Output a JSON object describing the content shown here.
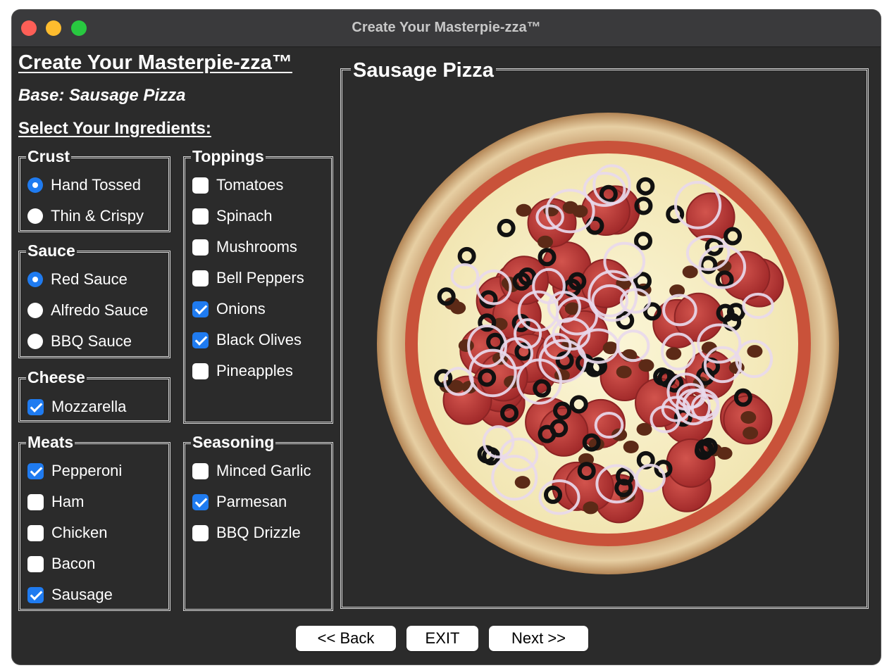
{
  "window": {
    "title": "Create Your Masterpie-zza™"
  },
  "heading": "Create Your Masterpie-zza™",
  "base_label": "Base: Sausage Pizza",
  "select_label": "Select Your Ingredients:",
  "groups": {
    "crust": {
      "title": "Crust",
      "options": [
        {
          "label": "Hand Tossed",
          "selected": true
        },
        {
          "label": "Thin & Crispy",
          "selected": false
        }
      ]
    },
    "sauce": {
      "title": "Sauce",
      "options": [
        {
          "label": "Red Sauce",
          "selected": true
        },
        {
          "label": "Alfredo Sauce",
          "selected": false
        },
        {
          "label": "BBQ Sauce",
          "selected": false
        }
      ]
    },
    "cheese": {
      "title": "Cheese",
      "options": [
        {
          "label": "Mozzarella",
          "checked": true
        }
      ]
    },
    "meats": {
      "title": "Meats",
      "options": [
        {
          "label": "Pepperoni",
          "checked": true
        },
        {
          "label": "Ham",
          "checked": false
        },
        {
          "label": "Chicken",
          "checked": false
        },
        {
          "label": "Bacon",
          "checked": false
        },
        {
          "label": "Sausage",
          "checked": true
        }
      ]
    },
    "toppings": {
      "title": "Toppings",
      "options": [
        {
          "label": "Tomatoes",
          "checked": false
        },
        {
          "label": "Spinach",
          "checked": false
        },
        {
          "label": "Mushrooms",
          "checked": false
        },
        {
          "label": "Bell Peppers",
          "checked": false
        },
        {
          "label": "Onions",
          "checked": true
        },
        {
          "label": "Black Olives",
          "checked": true
        },
        {
          "label": "Pineapples",
          "checked": false
        }
      ]
    },
    "seasoning": {
      "title": "Seasoning",
      "options": [
        {
          "label": "Minced Garlic",
          "checked": false
        },
        {
          "label": "Parmesan",
          "checked": true
        },
        {
          "label": "BBQ Drizzle",
          "checked": false
        }
      ]
    }
  },
  "preview": {
    "title": "Sausage Pizza"
  },
  "buttons": {
    "back": "<< Back",
    "exit": "EXIT",
    "next": "Next >>"
  },
  "colors": {
    "accent": "#1f7bf0",
    "window_bg": "#2b2b2b",
    "titlebar": "#3a3a3c"
  }
}
